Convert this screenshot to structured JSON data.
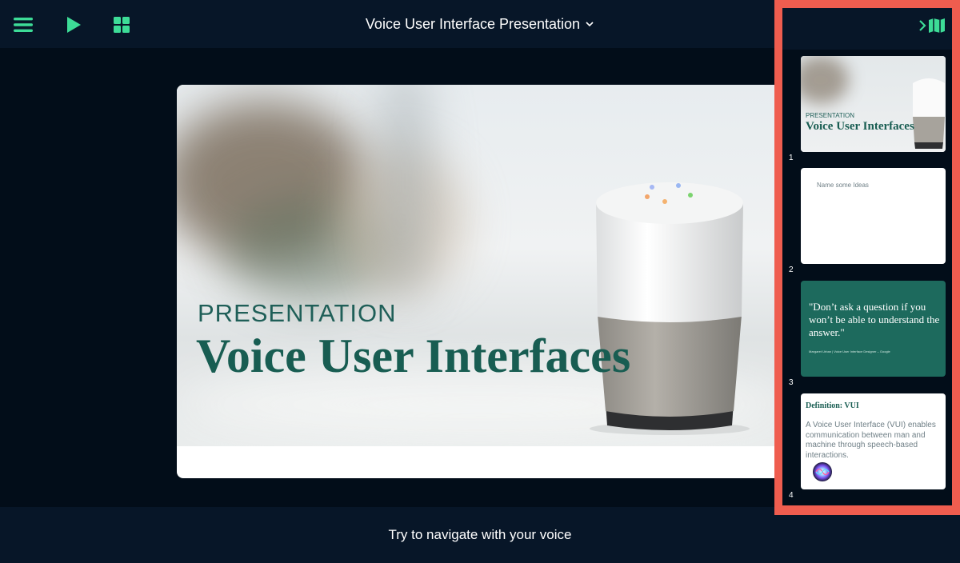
{
  "topbar": {
    "menu_icon": "hamburger-menu-icon",
    "play_icon": "play-icon",
    "grid_icon": "grid-icon",
    "title": "Voice User Interface Presentation",
    "title_chevron_icon": "chevron-down-icon",
    "accent_color": "#3ddc97"
  },
  "main_slide": {
    "kicker": "PRESENTATION",
    "heading": "Voice User Interfaces"
  },
  "footer": {
    "hint": "Try to navigate with your voice"
  },
  "panel": {
    "collapse_icon": "chevron-right-icon",
    "map_icon": "map-icon",
    "highlight_color": "#ef5d4f",
    "slides": [
      {
        "number": "1",
        "kicker": "PRESENTATION",
        "heading": "Voice User Interfaces"
      },
      {
        "number": "2",
        "text": "Name some Ideas"
      },
      {
        "number": "3",
        "quote": "\"Don’t ask a question if you won’t be able to understand the answer.\"",
        "attribution": "Margaret Urban | Voice User Interface Designer – Google"
      },
      {
        "number": "4",
        "heading": "Definition: VUI",
        "body": "A Voice User Interface (VUI) enables communication between man and machine through speech-based interactions."
      }
    ]
  }
}
